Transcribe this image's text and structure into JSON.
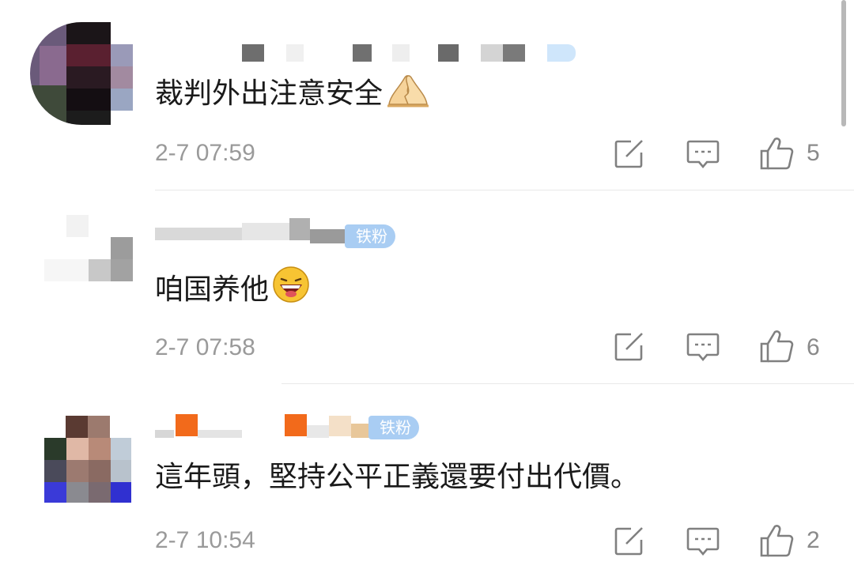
{
  "comments": [
    {
      "text": "裁判外出注意安全",
      "emoji": "folded-hands-emoji",
      "time": "2-7 07:59",
      "likes": "5"
    },
    {
      "text": "咱国养他",
      "emoji": "laughing-face-emoji",
      "time": "2-7 07:58",
      "likes": "6",
      "badge": "铁粉"
    },
    {
      "text": "這年頭，堅持公平正義還要付出代價。",
      "time": "2-7 10:54",
      "likes": "2",
      "badge": "铁粉"
    }
  ],
  "icons": {
    "share": "share-edit-icon",
    "reply": "comment-icon",
    "like": "thumbs-up-icon"
  },
  "colors": {
    "badge": "#a9cdf3",
    "time": "#9a9a9a",
    "text": "#1a1a1a"
  }
}
